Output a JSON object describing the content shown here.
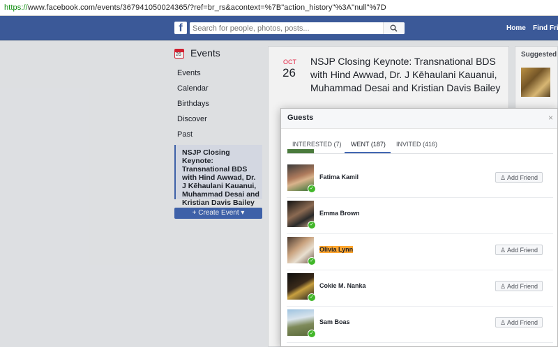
{
  "browser": {
    "url_scheme": "https://",
    "url_rest": "www.facebook.com/events/367941050024365/?ref=br_rs&acontext=%7B\"action_history\"%3A\"null\"%7D"
  },
  "header": {
    "logo": "f",
    "search_placeholder": "Search for people, photos, posts...",
    "nav": [
      "Home",
      "Find Frie"
    ]
  },
  "left_nav": {
    "title": "Events",
    "calendar_day": "26",
    "items": [
      "Events",
      "Calendar",
      "Birthdays",
      "Discover",
      "Past"
    ],
    "active_item": "NSJP Closing Keynote: Transnational BDS with Hind Awwad, Dr. J Kēhaulani Kauanui, Muhammad Desai and Kristian Davis Bailey",
    "create_button": "+ Create Event ▾"
  },
  "event": {
    "month": "OCT",
    "day": "26",
    "title": "NSJP Closing Keynote: Transnational BDS with Hind Awwad, Dr. J Kēhaulani Kauanui, Muhammad Desai and Kristian Davis Bailey"
  },
  "right_sidebar": {
    "heading": "Suggested Ev"
  },
  "modal": {
    "title": "Guests",
    "close": "×",
    "tabs": [
      "INTERESTED (7)",
      "WENT (187)",
      "INVITED (416)"
    ],
    "active_tab": "WENT (187)",
    "add_friend_label": "Add Friend",
    "guests": [
      {
        "name": "Fatima Kamil",
        "has_button": true,
        "highlight": false
      },
      {
        "name": "Emma Brown",
        "has_button": false,
        "highlight": false
      },
      {
        "name": "Olivia Lynn",
        "has_button": true,
        "highlight": true
      },
      {
        "name": "Cokie M. Nanka",
        "has_button": true,
        "highlight": false
      },
      {
        "name": "Sam Boas",
        "has_button": true,
        "highlight": false
      }
    ]
  },
  "colors": {
    "facebook_blue": "#3b5998",
    "button_blue": "#4267b2",
    "went_check": "#42b72a",
    "highlight": "#ffa630"
  }
}
